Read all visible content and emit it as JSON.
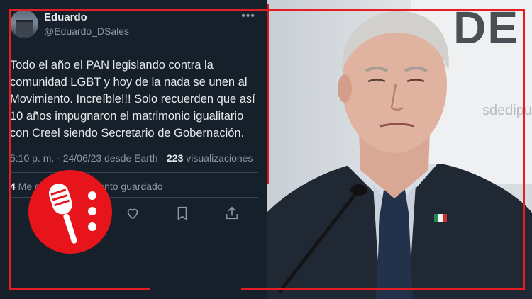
{
  "tweet": {
    "display_name": "Eduardo",
    "handle": "@Eduardo_DSales",
    "text": "Todo el año el PAN legislando contra la\ncomunidad LGBT y hoy de la nada se unen al\nMovimiento. Increíble!!! Solo recuerden que así\n10 años impugnaron el matrimonio igualitario\ncon Creel siendo Secretario de Gobernación.",
    "timestamp": "5:10 p. m. · 24/06/23 desde Earth · ",
    "views_count": "223",
    "views_label": " visualizaciones",
    "saved_count": "4",
    "saved_label": " Me gusta · 1 Elemento guardado"
  },
  "photo": {
    "sign_letters": "DE",
    "sign_url": "sdedipu"
  },
  "colors": {
    "tweet_background": "#15202b",
    "frame_red": "#e31e24",
    "logo_red": "#e8141c"
  },
  "icons": [
    "more-dots-icon",
    "reply-icon",
    "like-icon",
    "bookmark-icon",
    "share-icon",
    "microphone-icon"
  ]
}
